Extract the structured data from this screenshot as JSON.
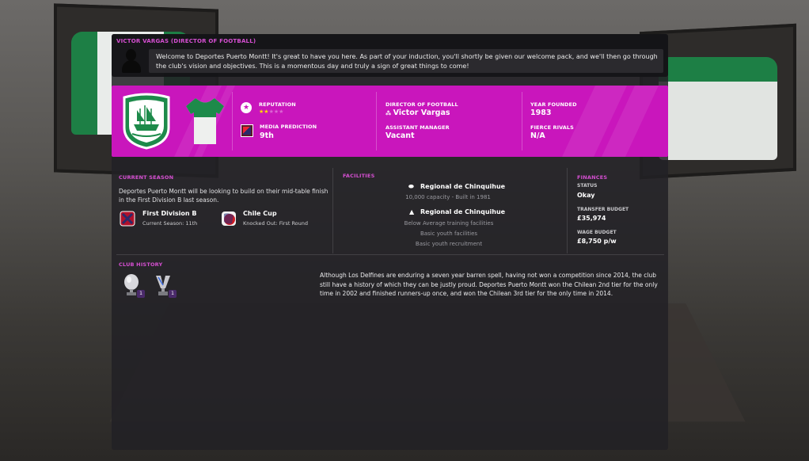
{
  "message": {
    "title": "VICTOR VARGAS (DIRECTOR OF FOOTBALL)",
    "text": "Welcome to Deportes Puerto Montt! It's great to have you here. As part of your induction, you'll shortly be given our welcome pack, and we'll then go through the club's vision and objectives. This is a momentous day and truly a sign of great things to come!"
  },
  "banner": {
    "reputation_label": "REPUTATION",
    "reputation_stars": 2,
    "reputation_max": 5,
    "media_label": "MEDIA PREDICTION",
    "media_value": "9th",
    "dof_label": "DIRECTOR OF FOOTBALL",
    "dof_value": "Victor Vargas",
    "asst_label": "ASSISTANT MANAGER",
    "asst_value": "Vacant",
    "founded_label": "YEAR FOUNDED",
    "founded_value": "1983",
    "rivals_label": "FIERCE RIVALS",
    "rivals_value": "N/A",
    "accent": "#c916bc"
  },
  "current_season": {
    "title": "CURRENT SEASON",
    "text": "Deportes Puerto Montt will be looking to build on their mid-table finish in the First Division B last season.",
    "competitions": [
      {
        "name": "First Division B",
        "sub": "Current Season: 11th",
        "icon": "league-icon"
      },
      {
        "name": "Chile Cup",
        "sub": "Knocked Out: First Round",
        "icon": "cup-icon"
      }
    ]
  },
  "facilities": {
    "title": "FACILITIES",
    "stadium": "Regional de Chinquihue",
    "stadium_sub": "10,000 capacity  -  Built in 1981",
    "training": "Regional de Chinquihue",
    "training_lines": [
      "Below Average training facilities",
      "Basic youth facilities",
      "Basic youth recruitment"
    ]
  },
  "finances": {
    "title": "FINANCES",
    "status_label": "STATUS",
    "status_value": "Okay",
    "transfer_label": "TRANSFER BUDGET",
    "transfer_value": "£35,974",
    "wage_label": "WAGE BUDGET",
    "wage_value": "£8,750 p/w"
  },
  "history": {
    "title": "CLUB HISTORY",
    "trophies": [
      {
        "icon": "league-trophy-icon",
        "count": "1"
      },
      {
        "icon": "cup-trophy-icon",
        "count": "1"
      }
    ],
    "text": "Although Los Delfines are enduring a seven year barren spell, having not won a competition since 2014, the club still have a history of which they can be justly proud. Deportes Puerto Montt won the Chilean 2nd tier for the only time in 2002 and finished runners-up once, and won the Chilean 3rd tier for the only time in 2014."
  }
}
